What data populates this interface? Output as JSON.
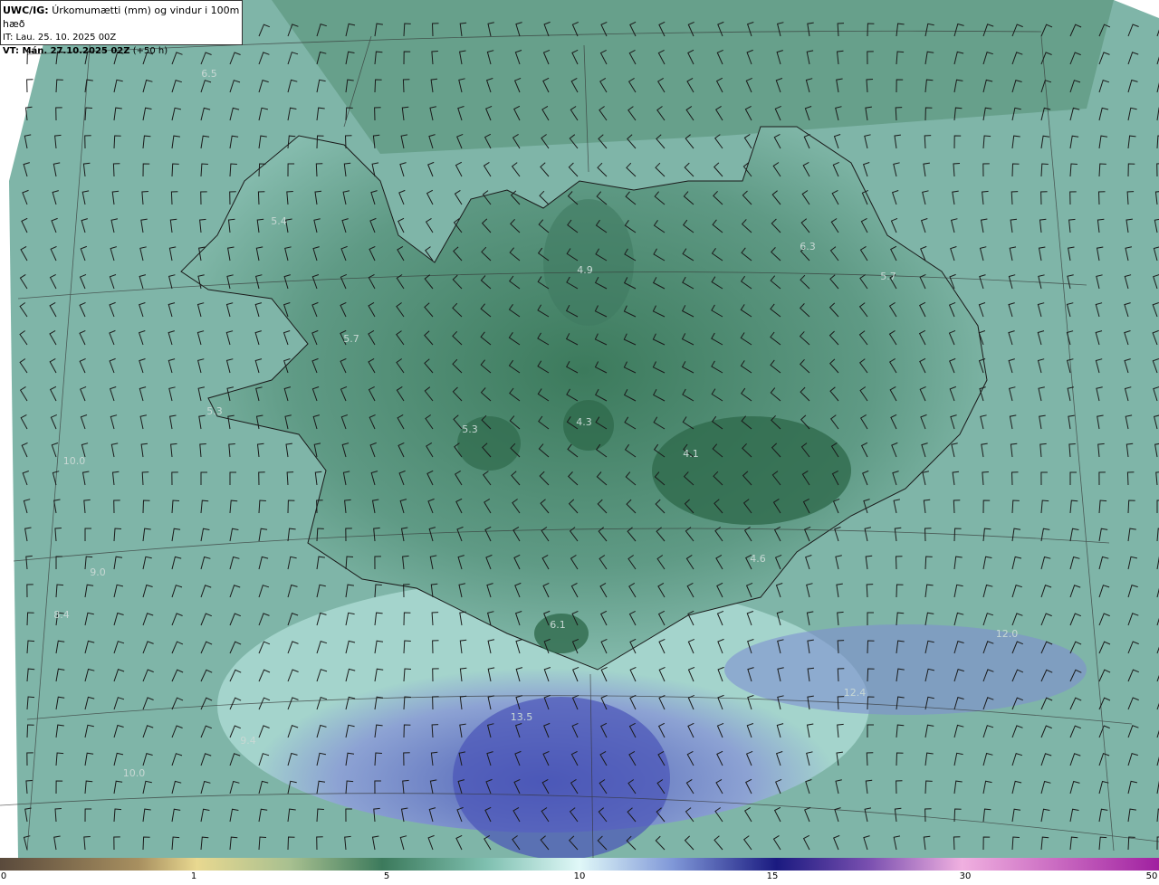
{
  "header": {
    "model": "UWC/IG:",
    "title": "Úrkomumætti (mm) og vindur i 100m hæð",
    "it_line": "IT: Lau. 25. 10. 2025 00Z",
    "vt_prefix": "VT: Mán. 27.10.2025 02Z",
    "vt_suffix": "(+50 h)"
  },
  "map_labels": [
    "6.5",
    "5.4",
    "5.7",
    "5.3",
    "4.9",
    "6.3",
    "5.7",
    "5.3",
    "4.3",
    "4.1",
    "4.6",
    "6.1",
    "10.0",
    "13.5",
    "12.4",
    "12.0",
    "10.0",
    "9.4",
    "8.4",
    "9.0"
  ],
  "colorbar": {
    "ticks": [
      "0",
      "1",
      "5",
      "10",
      "15",
      "30",
      "50"
    ],
    "colors": [
      "#5a4a3c",
      "#a89060",
      "#e8d890",
      "#7fae8a",
      "#3c7a5c",
      "#9ed8d0",
      "#e0f8f8",
      "#6070c8",
      "#2a2a90",
      "#8848a8",
      "#f0b0e0",
      "#a020a0"
    ]
  }
}
